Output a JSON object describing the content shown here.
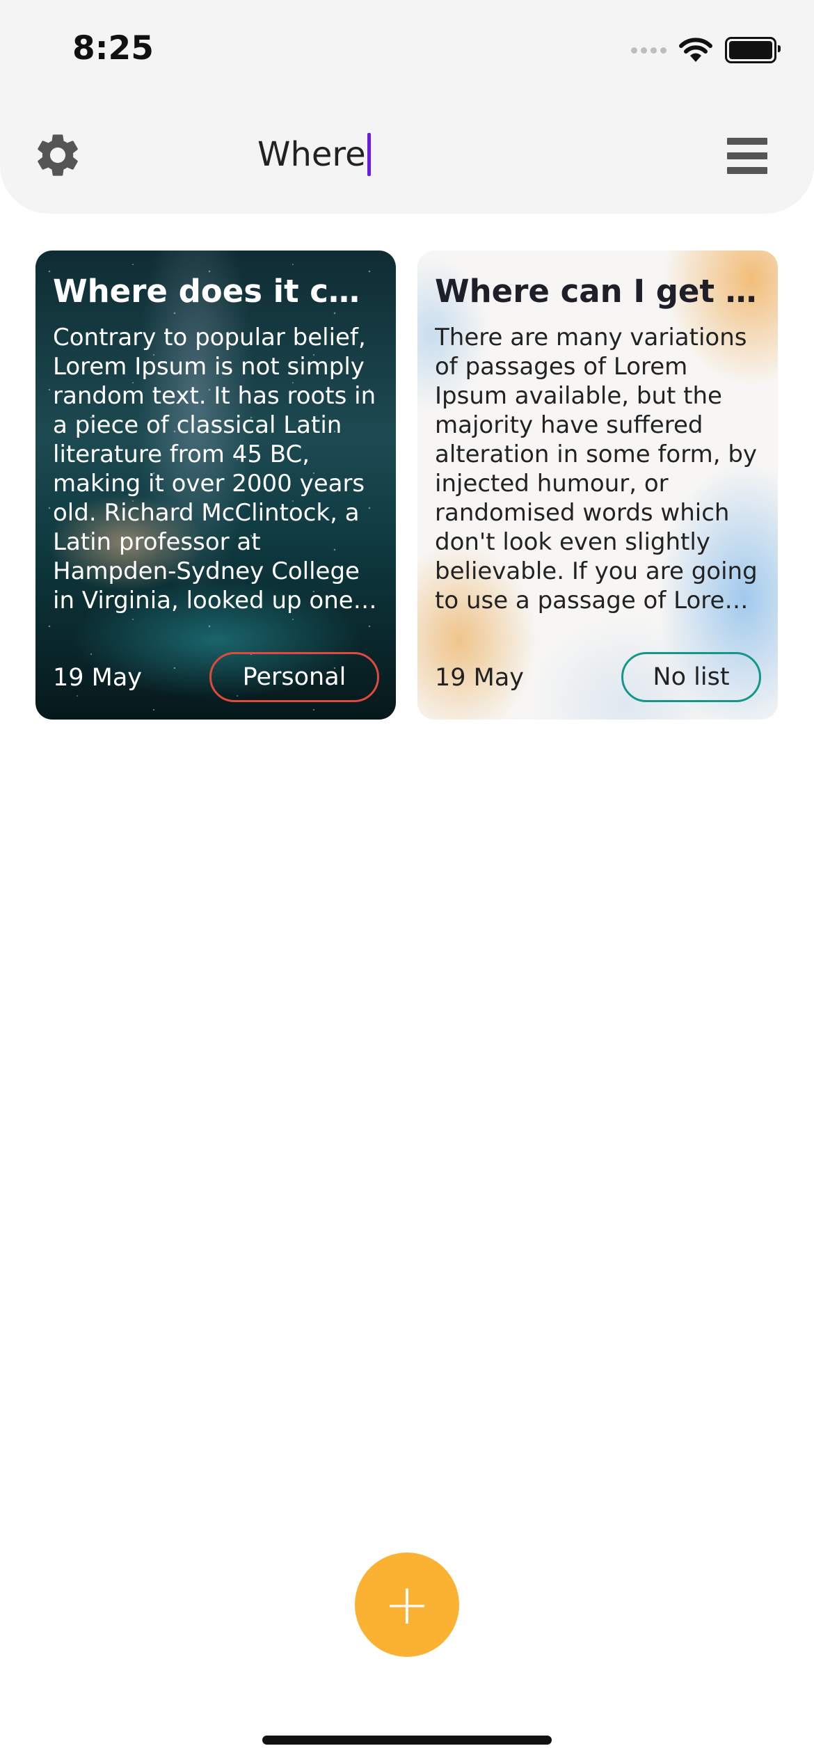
{
  "status_bar": {
    "time": "8:25",
    "icons": [
      "cellular-signal-icon",
      "wifi-icon",
      "battery-icon"
    ]
  },
  "header": {
    "settings_icon": "gear-icon",
    "search_value": "Where",
    "menu_icon": "hamburger-menu-icon"
  },
  "notes": [
    {
      "title": "Where does it come from?",
      "body": "Contrary to popular belief, Lorem Ipsum is not simply random text. It has roots in a piece of classical Latin literature from 45 BC, making it over 2000 years old. Richard McClintock, a Latin professor at Hampden-Sydney College in Virginia, looked up one of the more obscure Latin words",
      "date": "19 May",
      "tag": "Personal",
      "tag_color": "#e04a3c",
      "background": "night-sky-galaxy"
    },
    {
      "title": "Where can I get some?",
      "body": "There are many variations of passages of Lorem Ipsum available, but the majority have suffered alteration in some form, by injected humour, or randomised words which don't look even slightly believable. If you are going to use a passage of Lorem Ipsum, you need to be sure",
      "date": "19 May",
      "tag": "No list",
      "tag_color": "#159688",
      "background": "watercolor-orange-blue"
    }
  ],
  "fab": {
    "label": "+",
    "color": "#fbb131"
  },
  "colors": {
    "caret": "#6a1de0",
    "topbar_bg": "#f4f4f4"
  }
}
